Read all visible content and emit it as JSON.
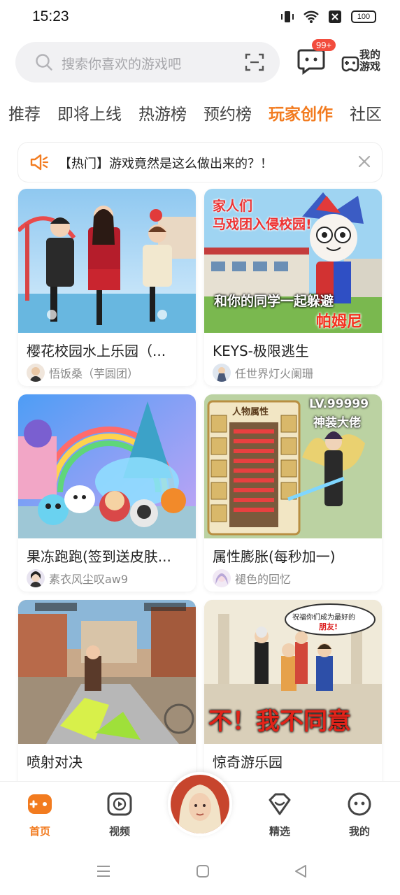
{
  "status": {
    "time": "15:23",
    "battery": "100"
  },
  "search": {
    "placeholder": "搜索你喜欢的游戏吧"
  },
  "header": {
    "message_badge": "99+",
    "my_games_line1": "我的",
    "my_games_line2": "游戏"
  },
  "tabs": [
    {
      "label": "推荐",
      "active": false
    },
    {
      "label": "即将上线",
      "active": false
    },
    {
      "label": "热游榜",
      "active": false
    },
    {
      "label": "预约榜",
      "active": false
    },
    {
      "label": "玩家创作",
      "active": true
    },
    {
      "label": "社区",
      "active": false
    }
  ],
  "notice": {
    "text": "【热门】游戏竟然是这么做出来的？！"
  },
  "cards": [
    {
      "title": "樱花校园水上乐园（...",
      "author": "悟饭桑（芋圆团）"
    },
    {
      "title": "KEYS-极限逃生",
      "author": "任世界灯火阑珊",
      "thumb_text_1": "家人们",
      "thumb_text_2": "马戏团入侵校园!",
      "thumb_text_3": "和你的同学一起躲避",
      "thumb_text_4": "帕姆尼"
    },
    {
      "title": "果冻跑跑(签到送皮肤...",
      "author": "素衣风尘叹aw9"
    },
    {
      "title": "属性膨胀(每秒加一)",
      "author": "褪色的回忆",
      "thumb_text_1": "LV.99999",
      "thumb_text_2": "神装大佬",
      "thumb_text_3": "人物属性"
    },
    {
      "title": "喷射对决",
      "author": ""
    },
    {
      "title": "惊奇游乐园",
      "author": "",
      "thumb_text_1": "祝福你们成为最好的",
      "thumb_text_2": "朋友!",
      "thumb_text_3": "不！我不同意"
    }
  ],
  "bottom_nav": [
    {
      "label": "首页",
      "icon": "gamepad-icon",
      "active": true
    },
    {
      "label": "视频",
      "icon": "play-icon",
      "active": false
    },
    {
      "label": "精选",
      "icon": "heart-diamond-icon",
      "active": false
    },
    {
      "label": "我的",
      "icon": "face-icon",
      "active": false
    }
  ],
  "colors": {
    "accent": "#f27b1f",
    "badge": "#f24c3d"
  }
}
